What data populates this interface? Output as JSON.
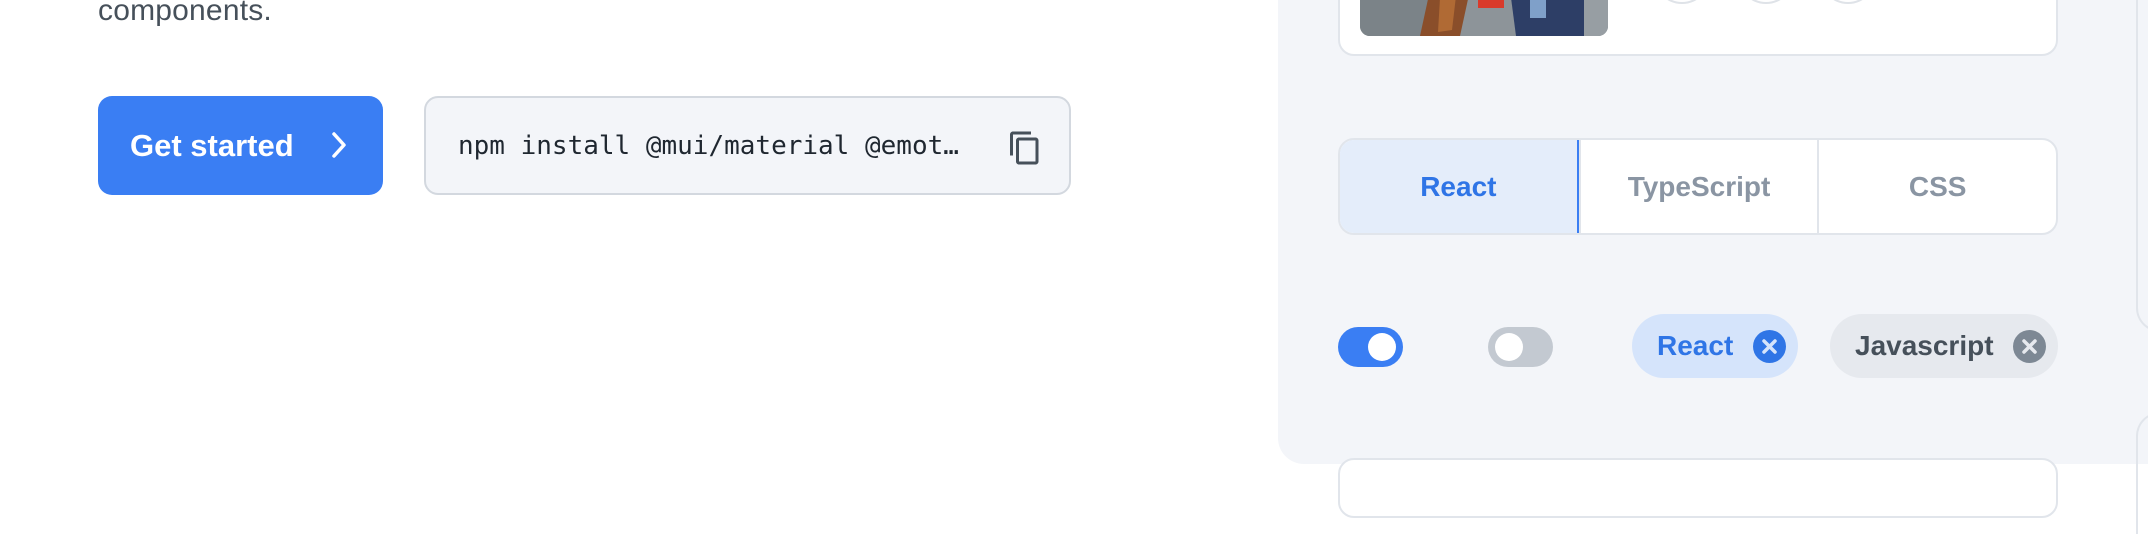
{
  "hero": {
    "intro_tail": "components.",
    "cta_label": "Get started",
    "install_command": "npm install @mui/material @emot…"
  },
  "showcase": {
    "segments": [
      "React",
      "TypeScript",
      "CSS"
    ],
    "active_segment": "React",
    "switches": [
      {
        "name": "switch-on",
        "checked": true
      },
      {
        "name": "switch-off",
        "checked": false
      }
    ],
    "chips": [
      {
        "label": "React",
        "variant": "primary"
      },
      {
        "label": "Javascript",
        "variant": "default"
      }
    ]
  },
  "icons": {
    "cta": "chevron-right-icon",
    "copy": "copy-icon",
    "chip_delete": "cancel-circle-icon"
  },
  "colors": {
    "primary": "#3a7ef3",
    "primary_light": "#d5e4fb",
    "panel_bg": "#f3f5f9",
    "chip_default_bg": "#e6e9ee",
    "text_muted": "#8a95a3"
  }
}
